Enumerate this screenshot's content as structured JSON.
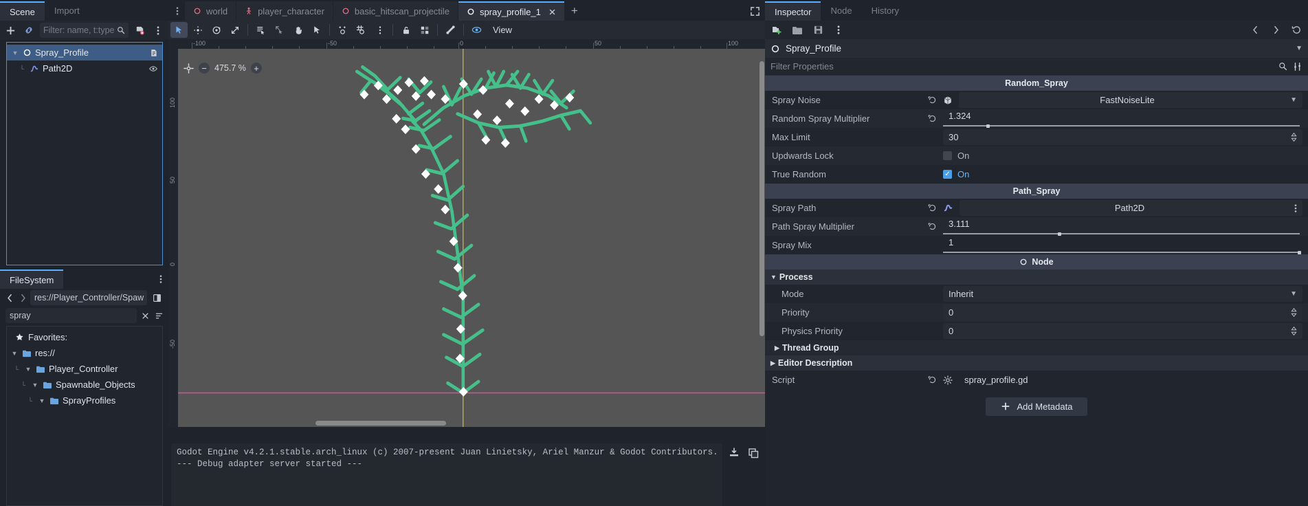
{
  "scene_panel": {
    "tabs": [
      {
        "label": "Scene",
        "active": true
      },
      {
        "label": "Import",
        "active": false
      }
    ],
    "toolbar": {
      "add_node_icon": "plus-icon",
      "instance_scene_icon": "link-icon",
      "filter_placeholder": "Filter: name, t:type",
      "search_icon": "search-icon",
      "script_icon": "script-remove-icon",
      "menu_icon": "kebab-menu-icon"
    },
    "tree": [
      {
        "label": "Spray_Profile",
        "icon": "node2d-icon",
        "depth": 0,
        "selected": true,
        "expander": "chevron-down-icon",
        "right_icon": "script-icon"
      },
      {
        "label": "Path2D",
        "icon": "path2d-icon",
        "depth": 1,
        "selected": false,
        "expander": "",
        "right_icon": "eye-icon"
      }
    ]
  },
  "filesystem": {
    "tab_label": "FileSystem",
    "menu_icon": "kebab-menu-icon",
    "back_icon": "chevron-left-icon",
    "forward_icon": "chevron-right-icon",
    "path": "res://Player_Controller/Spaw",
    "toggle_split_icon": "split-view-icon",
    "filter_value": "spray",
    "clear_icon": "close-icon",
    "sort_icon": "sort-icon",
    "tree": [
      {
        "label": "Favorites:",
        "depth": 0,
        "icon": "star-icon",
        "expander": ""
      },
      {
        "label": "res://",
        "depth": 0,
        "icon": "folder-icon",
        "expander": "chevron-down-icon"
      },
      {
        "label": "Player_Controller",
        "depth": 1,
        "icon": "folder-icon",
        "expander": "chevron-down-icon"
      },
      {
        "label": "Spawnable_Objects",
        "depth": 2,
        "icon": "folder-icon",
        "expander": "chevron-down-icon"
      },
      {
        "label": "SprayProfiles",
        "depth": 3,
        "icon": "folder-icon",
        "expander": "chevron-down-icon"
      }
    ]
  },
  "editor_tabs": {
    "menu_icon": "kebab-menu-icon",
    "items": [
      {
        "label": "world",
        "icon": "node2d-icon",
        "active": false
      },
      {
        "label": "player_character",
        "icon": "character-icon",
        "active": false
      },
      {
        "label": "basic_hitscan_projectile",
        "icon": "node2d-icon",
        "active": false
      },
      {
        "label": "spray_profile_1",
        "icon": "node2d-icon",
        "active": true,
        "close_icon": "close-icon"
      }
    ],
    "new_tab_label": "+",
    "expand_icon": "expand-icon"
  },
  "canvas_toolbar": {
    "buttons": [
      {
        "name": "select-mode",
        "icon": "cursor-arrow-icon",
        "active": true
      },
      {
        "name": "move-mode",
        "icon": "move-icon",
        "active": false
      },
      {
        "name": "rotate-mode",
        "icon": "rotate-icon",
        "active": false
      },
      {
        "name": "scale-mode",
        "icon": "scale-icon",
        "active": false
      },
      {
        "name": "list-select",
        "icon": "list-select-icon",
        "active": false
      },
      {
        "name": "ruler-mode",
        "icon": "ruler-icon",
        "active": false
      },
      {
        "name": "pan-mode",
        "icon": "hand-icon",
        "active": false
      },
      {
        "name": "selection-cursor",
        "icon": "pointer-icon",
        "active": false
      },
      {
        "name": "smart-snap",
        "icon": "smart-snap-icon",
        "active": false
      },
      {
        "name": "grid-snap",
        "icon": "grid-snap-icon",
        "active": false
      },
      {
        "name": "snap-options",
        "icon": "kebab-menu-icon",
        "active": false
      },
      {
        "name": "lock-selected",
        "icon": "lock-icon",
        "active": false
      },
      {
        "name": "group-selected",
        "icon": "group-icon",
        "active": false
      },
      {
        "name": "skeleton-options",
        "icon": "bone-icon",
        "active": false
      },
      {
        "name": "preview-canvas-scale",
        "icon": "eye-layers-icon",
        "active": false
      }
    ],
    "view_menu_label": "View"
  },
  "viewport": {
    "zoom_level": "475.7 %",
    "zoom_out_icon": "minus-circle-icon",
    "zoom_in_icon": "plus-circle-icon",
    "center_icon": "center-view-icon",
    "ruler_top_labels": [
      "-100",
      "-50",
      "0",
      "50",
      "100"
    ],
    "ruler_left_labels": [
      "100",
      "50",
      "0",
      "-50"
    ],
    "path_color": "#4cc38a",
    "point_color": "#ffffff",
    "guide_x_color": "#ffe06c",
    "guide_y_color": "#ff5599"
  },
  "output": {
    "lines": [
      "Godot Engine v4.2.1.stable.arch_linux (c) 2007-present Juan Linietsky, Ariel Manzur & Godot Contributors.",
      "--- Debug adapter server started ---"
    ],
    "clear_icon": "clear-output-icon",
    "copy_icon": "copy-icon"
  },
  "inspector": {
    "tabs": [
      {
        "label": "Inspector",
        "active": true
      },
      {
        "label": "Node",
        "active": false
      },
      {
        "label": "History",
        "active": false
      }
    ],
    "toolbar": {
      "new_resource_icon": "new-resource-icon",
      "load_icon": "folder-open-icon",
      "save_icon": "save-icon",
      "tools_icon": "kebab-menu-icon",
      "back_icon": "chevron-left-icon",
      "forward_icon": "chevron-right-icon",
      "history_icon": "history-icon"
    },
    "node_name": "Spray_Profile",
    "node_icon": "node2d-icon",
    "node_caret_icon": "chevron-down-icon",
    "open_docs_icon": "docs-icon",
    "filter_placeholder": "Filter Properties",
    "filter_search_icon": "search-icon",
    "filter_options_icon": "sliders-icon",
    "sections": [
      {
        "type": "category",
        "title": "Random_Spray",
        "properties": [
          {
            "label": "Spray Noise",
            "kind": "resource",
            "value": "FastNoiseLite",
            "revert": true,
            "res_icon": "resource-cube-icon",
            "caret": "chevron-down-icon"
          },
          {
            "label": "Random Spray Multiplier",
            "kind": "slider",
            "value": "1.324",
            "revert": true,
            "fill_pct": 12
          },
          {
            "label": "Max Limit",
            "kind": "spin",
            "value": "30",
            "revert": false
          },
          {
            "label": "Updwards Lock",
            "kind": "checkbox",
            "value": "On",
            "checked": false,
            "revert": false
          },
          {
            "label": "True Random",
            "kind": "checkbox",
            "value": "On",
            "checked": true,
            "revert": false
          }
        ]
      },
      {
        "type": "category",
        "title": "Path_Spray",
        "properties": [
          {
            "label": "Spray Path",
            "kind": "nodepath",
            "value": "Path2D",
            "revert": true,
            "res_icon": "path2d-icon",
            "menu": "kebab-menu-icon"
          },
          {
            "label": "Path Spray Multiplier",
            "kind": "slider",
            "value": "3.111",
            "revert": true,
            "fill_pct": 32
          },
          {
            "label": "Spray Mix",
            "kind": "slider",
            "value": "1",
            "revert": false,
            "fill_pct": 100
          }
        ]
      },
      {
        "type": "category",
        "title": "Node",
        "icon": "node2d-icon",
        "groups": [
          {
            "title": "Process",
            "expander": "chevron-down-icon",
            "properties": [
              {
                "label": "Mode",
                "kind": "enum",
                "value": "Inherit",
                "caret": "chevron-down-icon"
              },
              {
                "label": "Priority",
                "kind": "spin",
                "value": "0"
              },
              {
                "label": "Physics Priority",
                "kind": "spin",
                "value": "0"
              }
            ]
          },
          {
            "title": "Thread Group",
            "expander": "chevron-right-icon",
            "indent": true,
            "properties": []
          },
          {
            "title": "Editor Description",
            "expander": "chevron-right-icon",
            "indent": false,
            "properties": []
          }
        ],
        "script_row": {
          "label": "Script",
          "value": "spray_profile.gd",
          "revert_icon": "revert-icon",
          "gear_icon": "gear-icon"
        },
        "add_metadata": {
          "label": "Add Metadata",
          "icon": "plus-icon"
        }
      }
    ]
  }
}
